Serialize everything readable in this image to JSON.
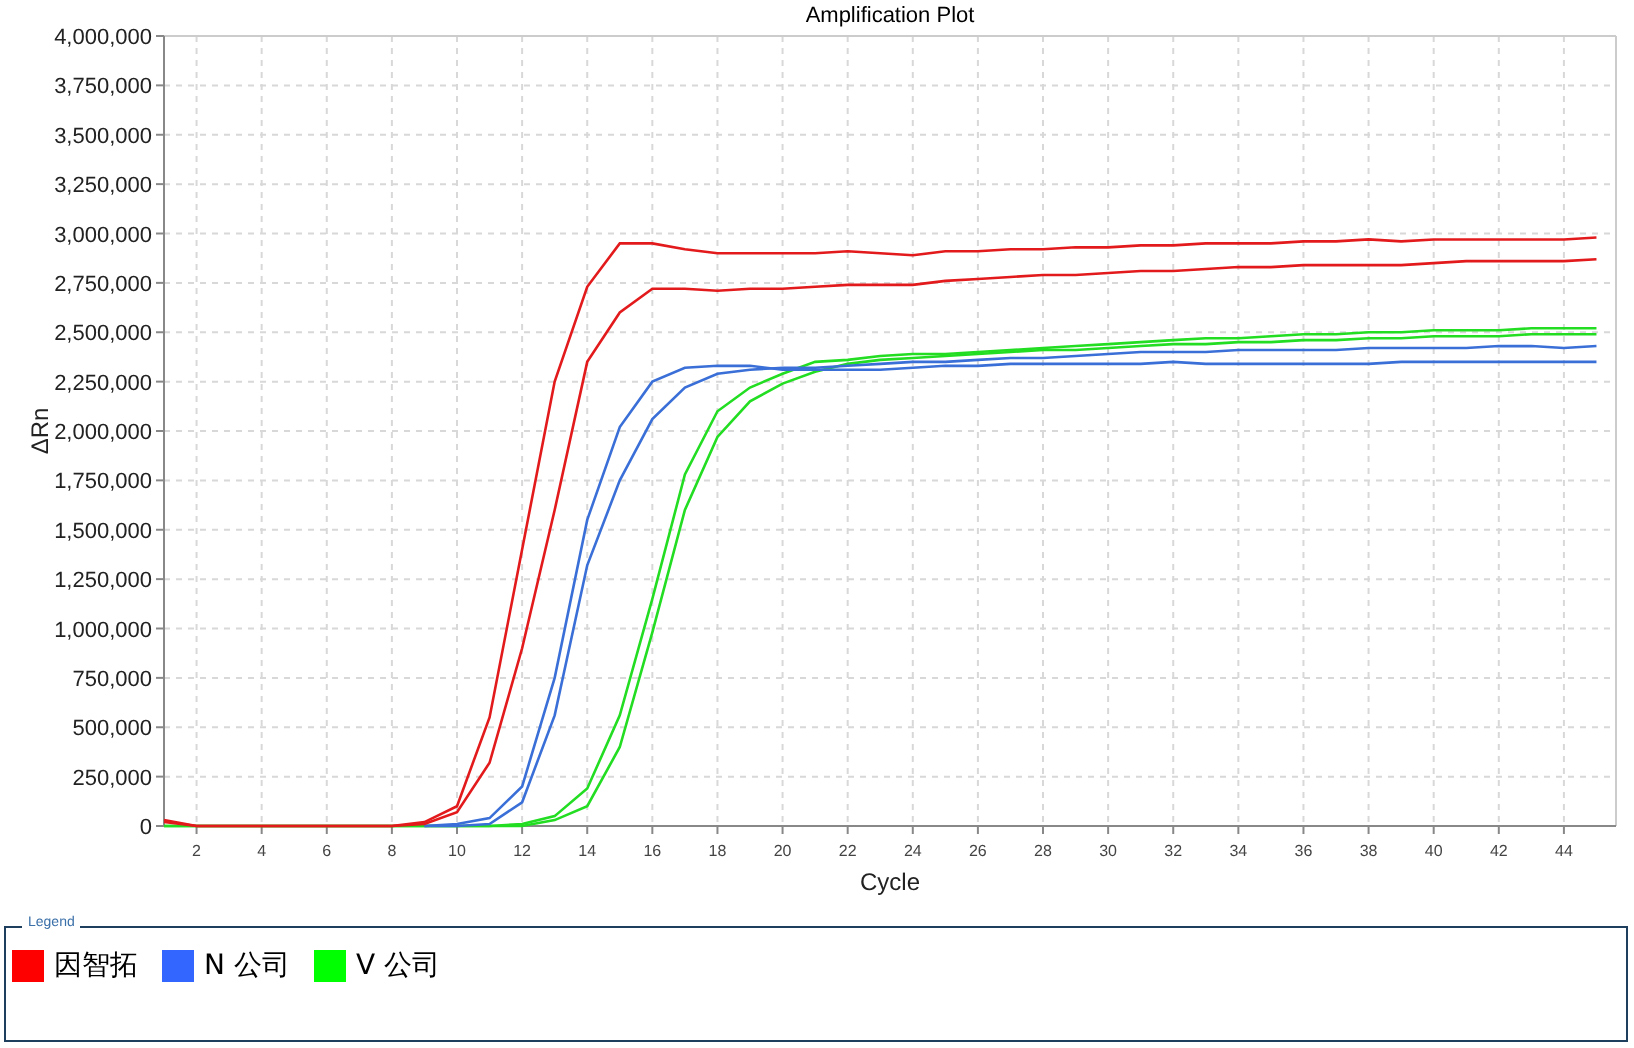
{
  "chart": {
    "chart_data": {
      "type": "line",
      "title": "Amplification Plot",
      "xlabel": "Cycle",
      "ylabel": "ΔRn",
      "x": [
        1,
        2,
        3,
        4,
        5,
        6,
        7,
        8,
        9,
        10,
        11,
        12,
        13,
        14,
        15,
        16,
        17,
        18,
        19,
        20,
        21,
        22,
        23,
        24,
        25,
        26,
        27,
        28,
        29,
        30,
        31,
        32,
        33,
        34,
        35,
        36,
        37,
        38,
        39,
        40,
        41,
        42,
        43,
        44,
        45
      ],
      "grid": true,
      "xlim": [
        1,
        45.6
      ],
      "ylim": [
        0,
        4000000
      ],
      "xticks": [
        2,
        4,
        6,
        8,
        10,
        12,
        14,
        16,
        18,
        20,
        22,
        24,
        26,
        28,
        30,
        32,
        34,
        36,
        38,
        40,
        42,
        44
      ],
      "yticks": [
        {
          "value": 0,
          "label": "0"
        },
        {
          "value": 250000,
          "label": "250,000"
        },
        {
          "value": 500000,
          "label": "500,000"
        },
        {
          "value": 750000,
          "label": "750,000"
        },
        {
          "value": 1000000,
          "label": "1,000,000"
        },
        {
          "value": 1250000,
          "label": "1,250,000"
        },
        {
          "value": 1500000,
          "label": "1,500,000"
        },
        {
          "value": 1750000,
          "label": "1,750,000"
        },
        {
          "value": 2000000,
          "label": "2,000,000"
        },
        {
          "value": 2250000,
          "label": "2,250,000"
        },
        {
          "value": 2500000,
          "label": "2,500,000"
        },
        {
          "value": 2750000,
          "label": "2,750,000"
        },
        {
          "value": 3000000,
          "label": "3,000,000"
        },
        {
          "value": 3250000,
          "label": "3,250,000"
        },
        {
          "value": 3500000,
          "label": "3,500,000"
        },
        {
          "value": 3750000,
          "label": "3,750,000"
        },
        {
          "value": 4000000,
          "label": "4,000,000"
        }
      ],
      "series": [
        {
          "color": "#e31a1c",
          "values": [
            30000,
            0,
            0,
            0,
            0,
            0,
            0,
            0,
            20000,
            100000,
            550000,
            1400000,
            2250000,
            2730000,
            2950000,
            2950000,
            2920000,
            2900000,
            2900000,
            2900000,
            2900000,
            2910000,
            2900000,
            2890000,
            2910000,
            2910000,
            2920000,
            2920000,
            2930000,
            2930000,
            2940000,
            2940000,
            2950000,
            2950000,
            2950000,
            2960000,
            2960000,
            2970000,
            2960000,
            2970000,
            2970000,
            2970000,
            2970000,
            2970000,
            2980000
          ]
        },
        {
          "color": "#e31a1c",
          "values": [
            20000,
            0,
            0,
            0,
            0,
            0,
            0,
            0,
            10000,
            70000,
            320000,
            900000,
            1600000,
            2350000,
            2600000,
            2720000,
            2720000,
            2710000,
            2720000,
            2720000,
            2730000,
            2740000,
            2740000,
            2740000,
            2760000,
            2770000,
            2780000,
            2790000,
            2790000,
            2800000,
            2810000,
            2810000,
            2820000,
            2830000,
            2830000,
            2840000,
            2840000,
            2840000,
            2840000,
            2850000,
            2860000,
            2860000,
            2860000,
            2860000,
            2870000
          ]
        },
        {
          "color": "#3a6fd8",
          "values": [
            null,
            null,
            null,
            null,
            null,
            null,
            null,
            null,
            0,
            10000,
            40000,
            200000,
            750000,
            1550000,
            2020000,
            2250000,
            2320000,
            2330000,
            2330000,
            2310000,
            2310000,
            2310000,
            2310000,
            2320000,
            2330000,
            2330000,
            2340000,
            2340000,
            2340000,
            2340000,
            2340000,
            2350000,
            2340000,
            2340000,
            2340000,
            2340000,
            2340000,
            2340000,
            2350000,
            2350000,
            2350000,
            2350000,
            2350000,
            2350000,
            2350000
          ]
        },
        {
          "color": "#3a6fd8",
          "values": [
            null,
            null,
            null,
            null,
            null,
            null,
            null,
            null,
            0,
            0,
            10000,
            120000,
            560000,
            1320000,
            1750000,
            2060000,
            2220000,
            2290000,
            2310000,
            2320000,
            2320000,
            2330000,
            2340000,
            2350000,
            2350000,
            2360000,
            2370000,
            2370000,
            2380000,
            2390000,
            2400000,
            2400000,
            2400000,
            2410000,
            2410000,
            2410000,
            2410000,
            2420000,
            2420000,
            2420000,
            2420000,
            2430000,
            2430000,
            2420000,
            2430000
          ]
        },
        {
          "color": "#22dd22",
          "values": [
            0,
            0,
            0,
            0,
            0,
            0,
            0,
            0,
            0,
            0,
            0,
            10000,
            50000,
            190000,
            560000,
            1150000,
            1780000,
            2100000,
            2220000,
            2290000,
            2350000,
            2360000,
            2380000,
            2390000,
            2390000,
            2400000,
            2410000,
            2420000,
            2430000,
            2440000,
            2450000,
            2460000,
            2470000,
            2470000,
            2480000,
            2490000,
            2490000,
            2500000,
            2500000,
            2510000,
            2510000,
            2510000,
            2520000,
            2520000,
            2520000
          ]
        },
        {
          "color": "#22dd22",
          "values": [
            0,
            0,
            0,
            0,
            0,
            0,
            0,
            0,
            0,
            0,
            0,
            0,
            30000,
            100000,
            400000,
            980000,
            1600000,
            1970000,
            2150000,
            2240000,
            2300000,
            2340000,
            2360000,
            2370000,
            2380000,
            2390000,
            2400000,
            2410000,
            2410000,
            2420000,
            2430000,
            2440000,
            2440000,
            2450000,
            2450000,
            2460000,
            2460000,
            2470000,
            2470000,
            2480000,
            2480000,
            2480000,
            2490000,
            2490000,
            2490000
          ]
        }
      ]
    }
  },
  "legend": {
    "title": "Legend",
    "items": [
      {
        "label": "因智拓",
        "color": "#ff0000"
      },
      {
        "label": "N 公司",
        "color": "#3366ff"
      },
      {
        "label": "V 公司",
        "color": "#00ff00"
      }
    ]
  }
}
